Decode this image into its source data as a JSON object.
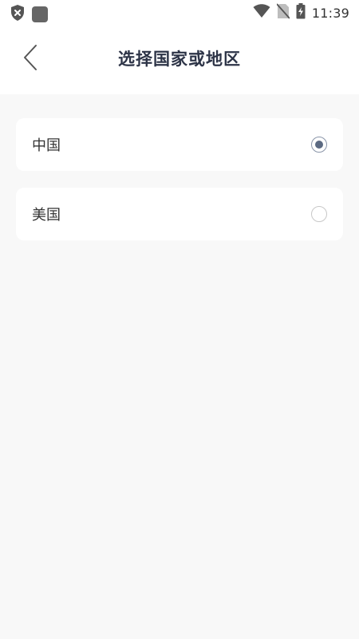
{
  "status_bar": {
    "time": "11:39",
    "icons": [
      "shield-x-icon",
      "app-icon",
      "wifi-icon",
      "no-sim-icon",
      "battery-charging-icon"
    ]
  },
  "header": {
    "title": "选择国家或地区",
    "back_icon": "chevron-left-icon"
  },
  "options": [
    {
      "label": "中国",
      "selected": true
    },
    {
      "label": "美国",
      "selected": false
    }
  ],
  "colors": {
    "background": "#f8f8f8",
    "card": "#ffffff",
    "title": "#2d3447",
    "radio_selected": "#5c6a82",
    "radio_border": "#c8c8c8"
  }
}
